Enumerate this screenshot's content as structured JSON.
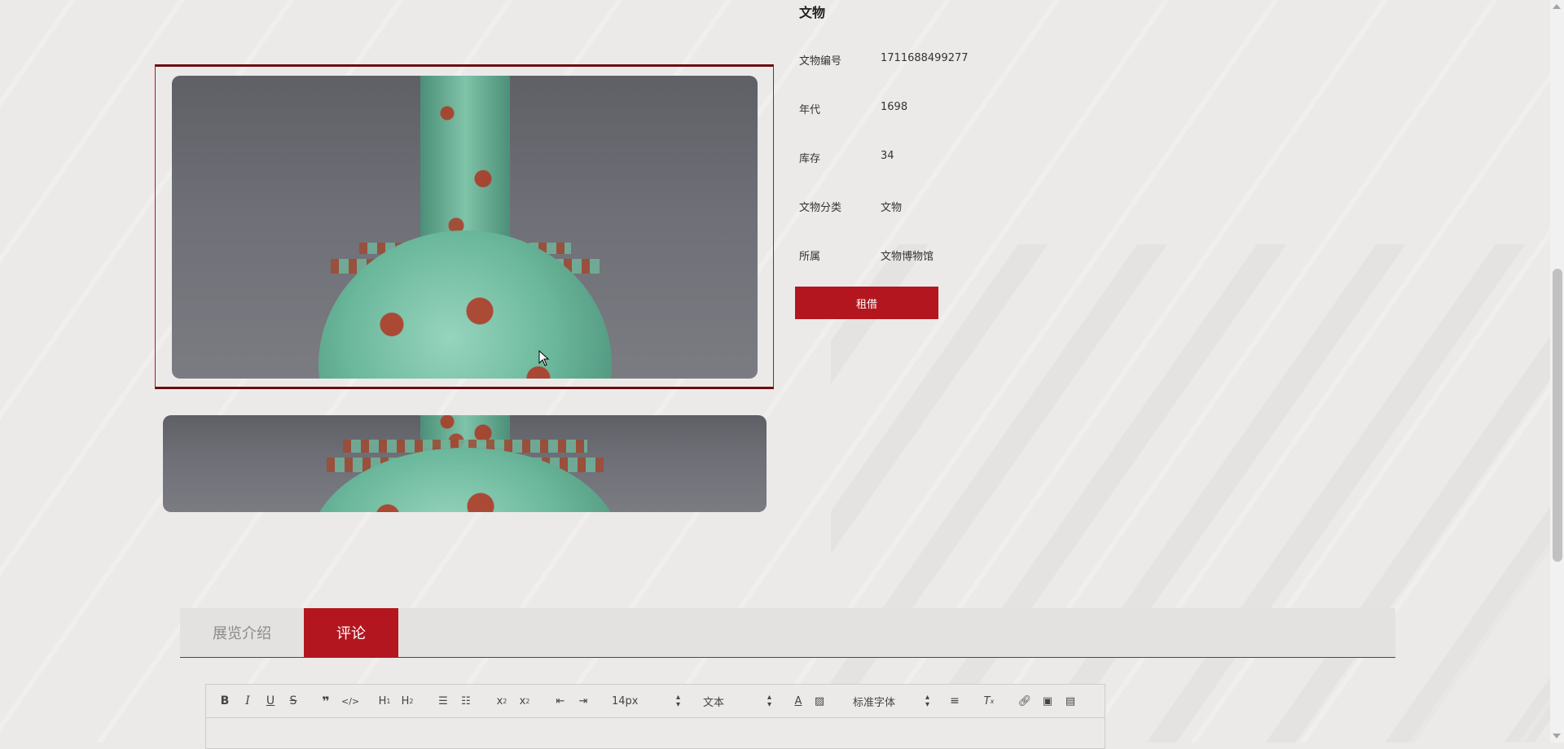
{
  "artifact": {
    "title": "文物",
    "fields": [
      {
        "label": "文物编号",
        "value": "1711688499277"
      },
      {
        "label": "年代",
        "value": "1698"
      },
      {
        "label": "库存",
        "value": "34"
      },
      {
        "label": "文物分类",
        "value": "文物"
      },
      {
        "label": "所属",
        "value": "文物博物馆"
      }
    ],
    "rent_label": "租借"
  },
  "tabs": [
    {
      "label": "展览介绍",
      "active": false
    },
    {
      "label": "评论",
      "active": true
    }
  ],
  "editor": {
    "font_size": "14px",
    "block_type": "文本",
    "font_family": "标准字体"
  },
  "colors": {
    "accent": "#b3161f",
    "frame": "#6b0d12"
  }
}
